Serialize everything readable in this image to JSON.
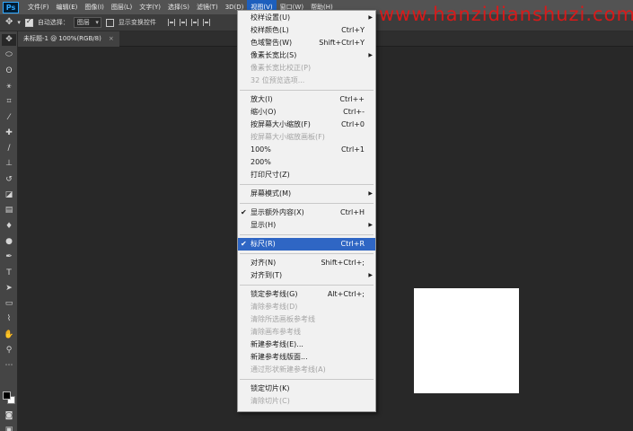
{
  "app": {
    "logo": "Ps"
  },
  "watermark": "www.hanzidianshuzi.com",
  "menubar": {
    "items": [
      "文件(F)",
      "编辑(E)",
      "图像(I)",
      "图层(L)",
      "文字(Y)",
      "选择(S)",
      "滤镜(T)",
      "3D(D)",
      "视图(V)",
      "窗口(W)",
      "帮助(H)"
    ],
    "active_index": 8
  },
  "options": {
    "auto_select_label": "自动选择：",
    "auto_select_checked": true,
    "layer_select_value": "图层",
    "show_transform_label": "显示变换控件",
    "show_transform_checked": false
  },
  "document": {
    "tab_title": "未标题-1 @ 100%(RGB/8)",
    "tab_close": "×"
  },
  "view_menu": {
    "items": [
      {
        "label": "校样设置(U)",
        "shortcut": "",
        "submenu": true,
        "disabled": false,
        "checked": false,
        "highlight": false
      },
      {
        "label": "校样颜色(L)",
        "shortcut": "Ctrl+Y",
        "submenu": false,
        "disabled": false,
        "checked": false,
        "highlight": false
      },
      {
        "label": "色域警告(W)",
        "shortcut": "Shift+Ctrl+Y",
        "submenu": false,
        "disabled": false,
        "checked": false,
        "highlight": false
      },
      {
        "label": "像素长宽比(S)",
        "shortcut": "",
        "submenu": true,
        "disabled": false,
        "checked": false,
        "highlight": false
      },
      {
        "label": "像素长宽比校正(P)",
        "shortcut": "",
        "submenu": false,
        "disabled": true,
        "checked": false,
        "highlight": false
      },
      {
        "label": "32 位预览选项...",
        "shortcut": "",
        "submenu": false,
        "disabled": true,
        "checked": false,
        "highlight": false
      },
      {
        "separator": true
      },
      {
        "label": "放大(I)",
        "shortcut": "Ctrl++",
        "submenu": false,
        "disabled": false,
        "checked": false,
        "highlight": false
      },
      {
        "label": "缩小(O)",
        "shortcut": "Ctrl+-",
        "submenu": false,
        "disabled": false,
        "checked": false,
        "highlight": false
      },
      {
        "label": "按屏幕大小缩放(F)",
        "shortcut": "Ctrl+0",
        "submenu": false,
        "disabled": false,
        "checked": false,
        "highlight": false
      },
      {
        "label": "按屏幕大小缩放画板(F)",
        "shortcut": "",
        "submenu": false,
        "disabled": true,
        "checked": false,
        "highlight": false
      },
      {
        "label": "100%",
        "shortcut": "Ctrl+1",
        "submenu": false,
        "disabled": false,
        "checked": false,
        "highlight": false
      },
      {
        "label": "200%",
        "shortcut": "",
        "submenu": false,
        "disabled": false,
        "checked": false,
        "highlight": false
      },
      {
        "label": "打印尺寸(Z)",
        "shortcut": "",
        "submenu": false,
        "disabled": false,
        "checked": false,
        "highlight": false
      },
      {
        "separator": true
      },
      {
        "label": "屏幕模式(M)",
        "shortcut": "",
        "submenu": true,
        "disabled": false,
        "checked": false,
        "highlight": false
      },
      {
        "separator": true
      },
      {
        "label": "显示额外内容(X)",
        "shortcut": "Ctrl+H",
        "submenu": false,
        "disabled": false,
        "checked": true,
        "highlight": false
      },
      {
        "label": "显示(H)",
        "shortcut": "",
        "submenu": true,
        "disabled": false,
        "checked": false,
        "highlight": false
      },
      {
        "separator": true
      },
      {
        "label": "标尺(R)",
        "shortcut": "Ctrl+R",
        "submenu": false,
        "disabled": false,
        "checked": true,
        "highlight": true
      },
      {
        "separator": true
      },
      {
        "label": "对齐(N)",
        "shortcut": "Shift+Ctrl+;",
        "submenu": false,
        "disabled": false,
        "checked": false,
        "highlight": false
      },
      {
        "label": "对齐到(T)",
        "shortcut": "",
        "submenu": true,
        "disabled": false,
        "checked": false,
        "highlight": false
      },
      {
        "separator": true
      },
      {
        "label": "锁定参考线(G)",
        "shortcut": "Alt+Ctrl+;",
        "submenu": false,
        "disabled": false,
        "checked": false,
        "highlight": false
      },
      {
        "label": "清除参考线(D)",
        "shortcut": "",
        "submenu": false,
        "disabled": true,
        "checked": false,
        "highlight": false
      },
      {
        "label": "清除所选画板参考线",
        "shortcut": "",
        "submenu": false,
        "disabled": true,
        "checked": false,
        "highlight": false
      },
      {
        "label": "清除画布参考线",
        "shortcut": "",
        "submenu": false,
        "disabled": true,
        "checked": false,
        "highlight": false
      },
      {
        "label": "新建参考线(E)...",
        "shortcut": "",
        "submenu": false,
        "disabled": false,
        "checked": false,
        "highlight": false
      },
      {
        "label": "新建参考线版面...",
        "shortcut": "",
        "submenu": false,
        "disabled": false,
        "checked": false,
        "highlight": false
      },
      {
        "label": "通过形状新建参考线(A)",
        "shortcut": "",
        "submenu": false,
        "disabled": true,
        "checked": false,
        "highlight": false
      },
      {
        "separator": true
      },
      {
        "label": "锁定切片(K)",
        "shortcut": "",
        "submenu": false,
        "disabled": false,
        "checked": false,
        "highlight": false
      },
      {
        "label": "清除切片(C)",
        "shortcut": "",
        "submenu": false,
        "disabled": true,
        "checked": false,
        "highlight": false
      }
    ]
  },
  "toolbar": {
    "tools": [
      {
        "name": "move-tool-icon",
        "glyph": "✥"
      },
      {
        "name": "marquee-tool-icon",
        "glyph": "⬭"
      },
      {
        "name": "lasso-tool-icon",
        "glyph": "ʘ"
      },
      {
        "name": "magic-wand-tool-icon",
        "glyph": "⚹"
      },
      {
        "name": "crop-tool-icon",
        "glyph": "⌗"
      },
      {
        "name": "eyedropper-tool-icon",
        "glyph": "⁄"
      },
      {
        "name": "healing-brush-tool-icon",
        "glyph": "✚"
      },
      {
        "name": "brush-tool-icon",
        "glyph": "∕"
      },
      {
        "name": "clone-stamp-tool-icon",
        "glyph": "⊥"
      },
      {
        "name": "history-brush-tool-icon",
        "glyph": "↺"
      },
      {
        "name": "eraser-tool-icon",
        "glyph": "◪"
      },
      {
        "name": "gradient-tool-icon",
        "glyph": "▤"
      },
      {
        "name": "blur-tool-icon",
        "glyph": "♦"
      },
      {
        "name": "dodge-tool-icon",
        "glyph": "●"
      },
      {
        "name": "pen-tool-icon",
        "glyph": "✒"
      },
      {
        "name": "type-tool-icon",
        "glyph": "T"
      },
      {
        "name": "path-selection-tool-icon",
        "glyph": "➤"
      },
      {
        "name": "shape-tool-icon",
        "glyph": "▭"
      },
      {
        "name": "custom-tool-icon",
        "glyph": "⌇"
      },
      {
        "name": "hand-tool-icon",
        "glyph": "✋"
      },
      {
        "name": "zoom-tool-icon",
        "glyph": "⚲"
      },
      {
        "name": "more-tools-icon",
        "glyph": "⋯"
      }
    ],
    "bottom_tools": [
      {
        "name": "quick-mask-icon",
        "glyph": "◙"
      },
      {
        "name": "screen-mode-icon",
        "glyph": "▣"
      }
    ],
    "foreground_color": "#000000",
    "background_color": "#ffffff"
  },
  "colors": {
    "menu_highlight": "#2f66c4",
    "canvas_bg": "#282828",
    "watermark": "#e01818"
  }
}
